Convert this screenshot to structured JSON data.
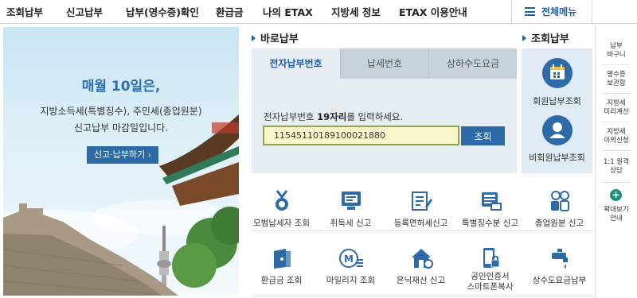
{
  "nav": {
    "items": [
      "조회납부",
      "신고납부",
      "납부(영수증)확인",
      "환급금",
      "나의 ETAX",
      "지방세 정보",
      "ETAX 이용안내"
    ],
    "menu_label": "전체메뉴"
  },
  "banner": {
    "title": "매월 10일은,",
    "line1": "지방소득세(특별징수), 주민세(종업원분)",
    "line2": "신고납부 마감일입니다.",
    "button": "신고·납부하기 ›"
  },
  "payment": {
    "heading": "바로납부",
    "tabs": [
      "전자납부번호",
      "납세번호",
      "상하수도요금"
    ],
    "active_tab": 0,
    "guide_pre": "전자납부번호 ",
    "guide_bold": "19자리",
    "guide_post": "를 입력하세요.",
    "input_value": "11545110189100021880",
    "submit_label": "조회"
  },
  "inquiry": {
    "heading": "조회납부",
    "member_label": "회원납부조회",
    "nonmember_label": "비회원납부조회"
  },
  "services": [
    {
      "label": "모범납세자 조회",
      "icon": "medal-icon"
    },
    {
      "label": "취득세 신고",
      "icon": "monitor-icon"
    },
    {
      "label": "등록면허세신고",
      "icon": "document-edit-icon"
    },
    {
      "label": "특별징수분 신고",
      "icon": "screen-icon"
    },
    {
      "label": "종업원분 신고",
      "icon": "people-icon"
    },
    {
      "label": "환급금 조회",
      "icon": "wallet-icon"
    },
    {
      "label": "마일리지 조회",
      "icon": "mileage-icon"
    },
    {
      "label": "은닉재산 신고",
      "icon": "house-icon"
    },
    {
      "label": "공인인증서\n스마트폰복사",
      "icon": "smartphone-lock-icon"
    },
    {
      "label": "상수도요금납부",
      "icon": "water-tap-icon"
    }
  ],
  "sidebar": [
    {
      "label": "납부\n바구니"
    },
    {
      "label": "영수증\n보관함"
    },
    {
      "label": "지방세\n미리계산"
    },
    {
      "label": "지방세\n이의신청"
    },
    {
      "label": "1:1 원격\n상담"
    },
    {
      "label": "확대보기\n안내"
    }
  ],
  "colors": {
    "primary": "#2d6aa6",
    "accent_text": "#1f5fa8",
    "panel_bg": "#e6edf3",
    "tab_inactive": "#c7d2dc",
    "input_bg": "#f9f7c9"
  }
}
